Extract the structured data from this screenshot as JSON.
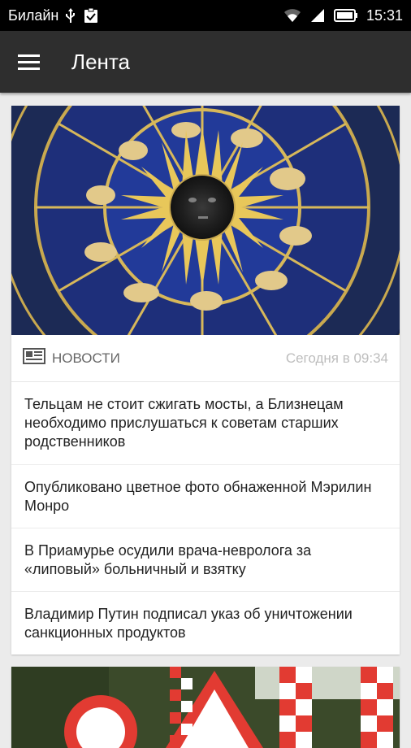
{
  "status_bar": {
    "carrier": "Билайн",
    "time": "15:31",
    "icons": [
      "usb-icon",
      "clipboard-check-icon",
      "wifi-icon",
      "signal-icon",
      "battery-icon"
    ]
  },
  "app_bar": {
    "title": "Лента",
    "menu_icon": "hamburger-menu-icon"
  },
  "feed": {
    "card": {
      "image": "zodiac-clock-image",
      "category": "НОВОСТИ",
      "category_icon": "newspaper-icon",
      "timestamp": "Сегодня в 09:34",
      "items": [
        {
          "title": "Тельцам не стоит сжигать мосты, а Близнецам необходимо прислушаться к советам старших родственников"
        },
        {
          "title": "Опубликовано цветное фото обнаженной Мэрилин Монро"
        },
        {
          "title": "В Приамурье осудили врача-невролога за «липовый» больничный и взятку"
        },
        {
          "title": "Владимир Путин подписал указ об уничтожении санкционных продуктов"
        }
      ]
    },
    "next_card": {
      "image": "road-signs-image"
    }
  },
  "colors": {
    "status_bar": "#000000",
    "app_bar": "#2e2e2e",
    "background": "#ebebeb",
    "timestamp": "#bdbdbd"
  }
}
